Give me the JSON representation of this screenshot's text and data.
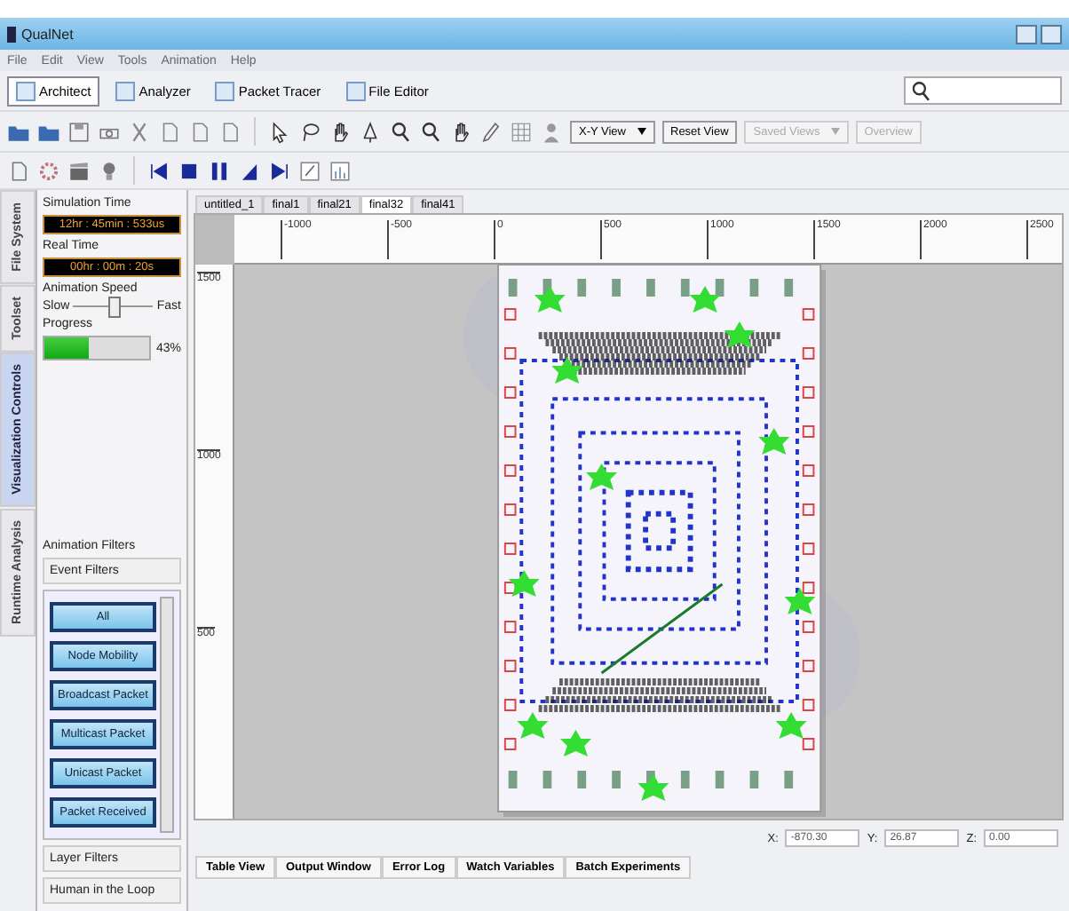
{
  "window": {
    "title": "QualNet"
  },
  "menu": [
    "File",
    "Edit",
    "View",
    "Tools",
    "Animation",
    "Help"
  ],
  "modes": [
    {
      "label": "Architect",
      "selected": true
    },
    {
      "label": "Analyzer",
      "selected": false
    },
    {
      "label": "Packet Tracer",
      "selected": false
    },
    {
      "label": "File Editor",
      "selected": false
    }
  ],
  "view_buttons": [
    {
      "label": "X-Y View",
      "kind": "dropdown",
      "disabled": false
    },
    {
      "label": "Reset View",
      "kind": "button",
      "disabled": false
    },
    {
      "label": "Saved Views",
      "kind": "dropdown",
      "disabled": true
    },
    {
      "label": "Overview",
      "kind": "button",
      "disabled": true
    }
  ],
  "side_tabs": [
    {
      "label": "File System",
      "selected": false
    },
    {
      "label": "Toolset",
      "selected": false
    },
    {
      "label": "Visualization Controls",
      "selected": true
    },
    {
      "label": "Runtime Analysis",
      "selected": false
    }
  ],
  "controls": {
    "simulation_time": {
      "label": "Simulation Time",
      "value": "12hr : 45min : 533us"
    },
    "real_time": {
      "label": "Real Time",
      "value": "00hr : 00m : 20s"
    },
    "animation_speed": {
      "label": "Animation Speed",
      "min_label": "Slow",
      "max_label": "Fast",
      "level": 0.5
    },
    "progress": {
      "label": "Progress",
      "level": 0.43,
      "reading": "43%"
    }
  },
  "filters": {
    "title": "Animation Filters",
    "header": "Event Filters",
    "events": [
      {
        "label": "All"
      },
      {
        "label": "Node Mobility"
      },
      {
        "label": "Broadcast Packet"
      },
      {
        "label": "Multicast Packet"
      },
      {
        "label": "Unicast Packet"
      },
      {
        "label": "Packet Received"
      }
    ],
    "sections": [
      "Layer Filters",
      "Human in the Loop"
    ]
  },
  "doc_tabs": [
    {
      "label": "untitled_1",
      "selected": false
    },
    {
      "label": "final1",
      "selected": false
    },
    {
      "label": "final21",
      "selected": false
    },
    {
      "label": "final32",
      "selected": true
    },
    {
      "label": "final41",
      "selected": false
    }
  ],
  "ruler": {
    "x_labels": [
      "-1000",
      "-500",
      "0",
      "500",
      "1000",
      "1500",
      "2000",
      "2500"
    ],
    "y_labels": [
      "1500",
      "1000",
      "500"
    ]
  },
  "coordinates": [
    {
      "label": "X:",
      "value": "-870.30"
    },
    {
      "label": "Y:",
      "value": "26.87"
    },
    {
      "label": "Z:",
      "value": "0.00"
    }
  ],
  "bottom_tabs": [
    "Table View",
    "Output Window",
    "Error Log",
    "Watch Variables",
    "Batch Experiments"
  ]
}
